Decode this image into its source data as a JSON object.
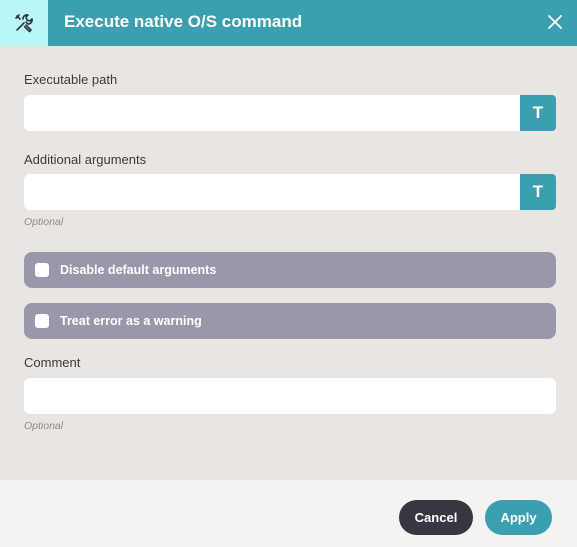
{
  "dialog": {
    "title": "Execute native O/S command",
    "header_icon": "tools-icon",
    "close_icon": "close-icon"
  },
  "fields": {
    "executable_path": {
      "label": "Executable path",
      "value": "",
      "type_button": "T"
    },
    "additional_arguments": {
      "label": "Additional arguments",
      "value": "",
      "type_button": "T",
      "hint": "Optional"
    },
    "comment": {
      "label": "Comment",
      "value": "",
      "hint": "Optional"
    }
  },
  "toggles": {
    "disable_default_arguments": {
      "label": "Disable default arguments",
      "checked": false
    },
    "treat_error_as_warning": {
      "label": "Treat error as a warning",
      "checked": false
    }
  },
  "footer": {
    "cancel_label": "Cancel",
    "apply_label": "Apply"
  },
  "colors": {
    "accent": "#3c9fb0",
    "header_icon_bg": "#b8f6f8",
    "toggle_bg": "#9a97ab",
    "cancel_bg": "#3a3640",
    "body_bg": "#e9e5e3"
  }
}
